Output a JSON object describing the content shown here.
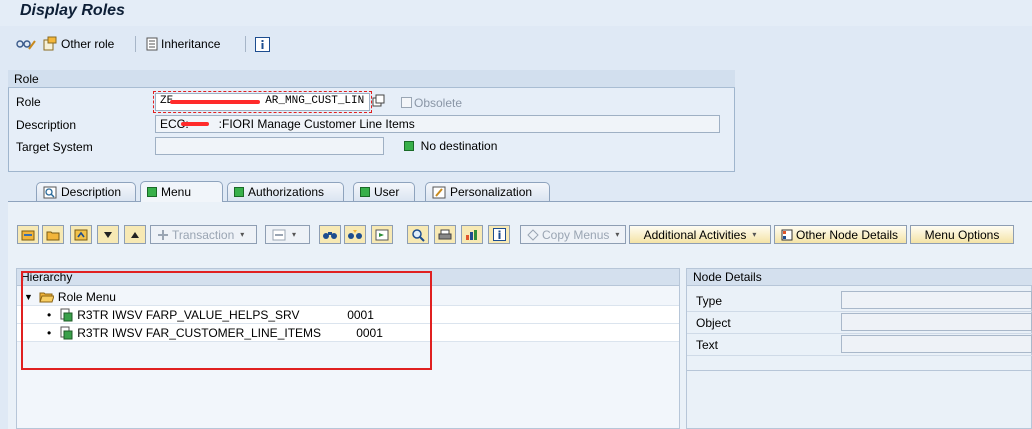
{
  "title": "Display Roles",
  "toolbar": {
    "other_role": "Other role",
    "inheritance": "Inheritance"
  },
  "role_group": {
    "header": "Role",
    "role_label": "Role",
    "role_value_prefix": "ZE",
    "role_value_suffix": "AR_MNG_CUST_LIN",
    "obsolete_label": "Obsolete",
    "description_label": "Description",
    "description_prefix": "ECC:",
    "description_suffix": ":FIORI Manage Customer Line Items",
    "target_system_label": "Target System",
    "target_system_value": "",
    "destination_status": "No destination"
  },
  "tabs": [
    {
      "label": "Description",
      "active": false
    },
    {
      "label": "Menu",
      "active": true
    },
    {
      "label": "Authorizations",
      "active": false
    },
    {
      "label": "User",
      "active": false
    },
    {
      "label": "Personalization",
      "active": false
    }
  ],
  "menu_toolbar": {
    "transaction": "Transaction",
    "copy_menus": "Copy Menus",
    "additional_activities": "Additional Activities",
    "other_node_details": "Other Node Details",
    "menu_options": "Menu Options"
  },
  "hierarchy": {
    "header": "Hierarchy",
    "root": "Role Menu",
    "items": [
      {
        "name": "R3TR IWSV FARP_VALUE_HELPS_SRV",
        "version": "0001"
      },
      {
        "name": "R3TR IWSV FAR_CUSTOMER_LINE_ITEMS",
        "version": "0001"
      }
    ]
  },
  "node_details": {
    "header": "Node Details",
    "type_label": "Type",
    "object_label": "Object",
    "text_label": "Text"
  },
  "colors": {
    "accent": "#e02020",
    "status_green": "#38b04a"
  }
}
